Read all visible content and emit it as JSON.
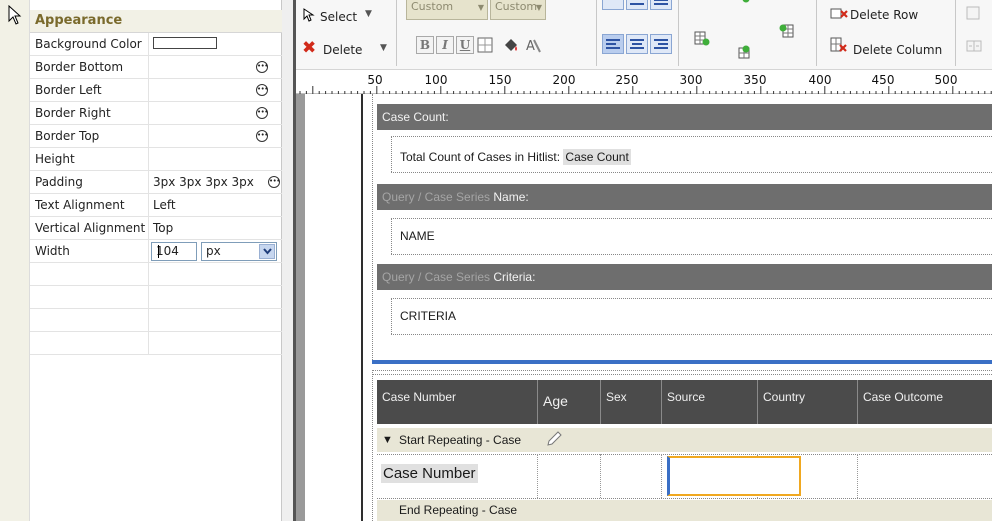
{
  "properties": {
    "section_title": "Appearance",
    "rows": [
      {
        "name": "Background Color",
        "value": "",
        "kind": "color"
      },
      {
        "name": "Border Bottom",
        "value": "",
        "kind": "ellipsis"
      },
      {
        "name": "Border Left",
        "value": "",
        "kind": "ellipsis"
      },
      {
        "name": "Border Right",
        "value": "",
        "kind": "ellipsis"
      },
      {
        "name": "Border Top",
        "value": "",
        "kind": "ellipsis"
      },
      {
        "name": "Height",
        "value": "",
        "kind": "text"
      },
      {
        "name": "Padding",
        "value": "3px 3px 3px 3px",
        "kind": "ellipsis"
      },
      {
        "name": "Text Alignment",
        "value": "Left",
        "kind": "text"
      },
      {
        "name": "Vertical Alignment",
        "value": "Top",
        "kind": "text"
      },
      {
        "name": "Width",
        "value": "104",
        "unit": "px",
        "kind": "width"
      }
    ]
  },
  "toolbar": {
    "select_label": "Select",
    "delete_label": "Delete",
    "font_combo": "Custom",
    "size_combo": "Custom",
    "bold": "B",
    "italic": "I",
    "underline": "U",
    "delete_row_label": "Delete Row",
    "delete_column_label": "Delete Column"
  },
  "ruler": {
    "labels": [
      "50",
      "100",
      "150",
      "200",
      "250",
      "300",
      "350",
      "400",
      "450",
      "500"
    ]
  },
  "canvas": {
    "case_count_band": "Case Count:",
    "total_count_label": "Total Count of Cases in Hitlist:",
    "total_count_field": "Case Count",
    "query_band_prefix": "Query / Case Series",
    "name_band_suffix": "Name:",
    "name_field": "NAME",
    "criteria_band_suffix": "Criteria:",
    "criteria_field": "CRITERIA",
    "columns": [
      "Case Number",
      "Age",
      "Sex",
      "Source",
      "Country",
      "Case Outcome"
    ],
    "start_repeating": "Start Repeating - Case",
    "case_number_field": "Case Number",
    "end_repeating": "End Repeating - Case"
  },
  "colors": {
    "band": "#6e6e6e",
    "table_header": "#4b4b4b",
    "selection_blue": "#3a6fc5",
    "selection_orange": "#f0a820",
    "repeat_band": "#e8e6d6"
  }
}
